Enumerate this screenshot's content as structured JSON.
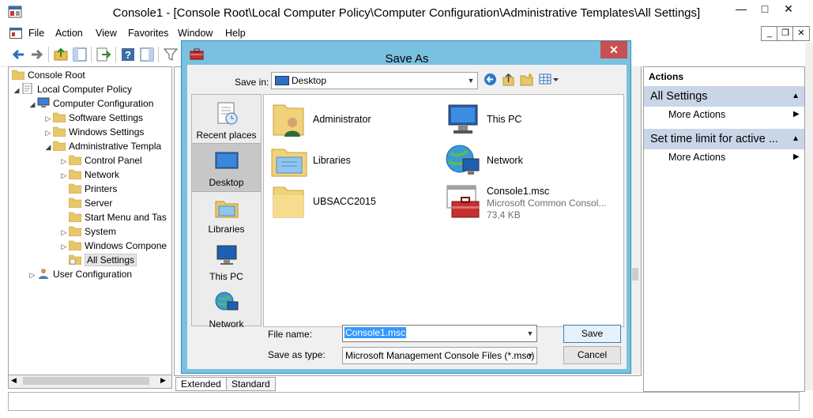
{
  "window": {
    "title": "Console1 - [Console Root\\Local Computer Policy\\Computer Configuration\\Administrative Templates\\All Settings]",
    "caption_buttons": {
      "minimize": "—",
      "maximize": "□",
      "close": "✕"
    }
  },
  "menu": [
    "File",
    "Action",
    "View",
    "Favorites",
    "Window",
    "Help"
  ],
  "mdi_buttons": {
    "minimize": "_",
    "restore": "❐",
    "close": "✕"
  },
  "tree": {
    "items": [
      {
        "label": "Console Root"
      },
      {
        "label": "Local Computer Policy"
      },
      {
        "label": "Computer Configuration"
      },
      {
        "label": "Software Settings"
      },
      {
        "label": "Windows Settings"
      },
      {
        "label": "Administrative Templa"
      },
      {
        "label": "Control Panel"
      },
      {
        "label": "Network"
      },
      {
        "label": "Printers"
      },
      {
        "label": "Server"
      },
      {
        "label": "Start Menu and Tas"
      },
      {
        "label": "System"
      },
      {
        "label": "Windows Compone"
      },
      {
        "label": "All Settings"
      },
      {
        "label": "User Configuration"
      }
    ]
  },
  "tabs": [
    "Extended",
    "Standard"
  ],
  "actions": {
    "header": "Actions",
    "sections": [
      {
        "title": "All Settings",
        "item": "More Actions"
      },
      {
        "title": "Set time limit for active ...",
        "item": "More Actions"
      }
    ]
  },
  "dialog": {
    "title": "Save As",
    "close": "✕",
    "save_in_label": "Save in:",
    "save_in_value": "Desktop",
    "places": [
      "Recent places",
      "Desktop",
      "Libraries",
      "This PC",
      "Network"
    ],
    "files": [
      {
        "name": "Administrator",
        "icon": "user-folder-icon"
      },
      {
        "name": "This PC",
        "icon": "computer-icon"
      },
      {
        "name": "Libraries",
        "icon": "libraries-icon"
      },
      {
        "name": "Network",
        "icon": "network-icon"
      },
      {
        "name": "UBSACC2015",
        "icon": "folder-icon"
      },
      {
        "name": "Console1.msc",
        "desc": "Microsoft Common Consol...",
        "size": "73,4 KB",
        "icon": "msc-toolbox-icon"
      }
    ],
    "file_name_label": "File name:",
    "file_name_value": "Console1.msc",
    "save_as_type_label": "Save as type:",
    "save_as_type_value": "Microsoft Management Console Files (*.msc)",
    "save_button": "Save",
    "cancel_button": "Cancel"
  },
  "colors": {
    "dialog_frame": "#7ac0e0",
    "close_red": "#c75050",
    "actions_header": "#c9d6e8",
    "selection": "#3399ff"
  }
}
